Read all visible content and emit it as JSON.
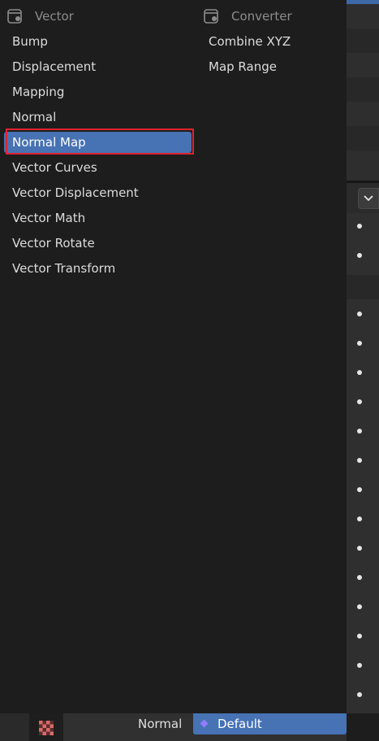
{
  "menu": {
    "vector": {
      "header": "Vector",
      "items": [
        {
          "label": "Bump"
        },
        {
          "label": "Displacement"
        },
        {
          "label": "Mapping"
        },
        {
          "label": "Normal"
        },
        {
          "label": "Normal Map",
          "selected": true
        },
        {
          "label": "Vector Curves"
        },
        {
          "label": "Vector Displacement"
        },
        {
          "label": "Vector Math"
        },
        {
          "label": "Vector Rotate"
        },
        {
          "label": "Vector Transform"
        }
      ]
    },
    "converter": {
      "header": "Converter",
      "items": [
        {
          "label": "Combine XYZ"
        },
        {
          "label": "Map Range"
        }
      ]
    }
  },
  "bottom_bar": {
    "label": "Normal",
    "select_value": "Default"
  },
  "colors": {
    "accent": "#4772b3",
    "highlight_border": "#e0232e",
    "background": "#1d1d1d"
  },
  "icons": {
    "category": "node-category-icon",
    "dropdown": "chevron-down-icon",
    "texture": "checker-texture-icon",
    "socket": "socket-diamond-icon"
  }
}
